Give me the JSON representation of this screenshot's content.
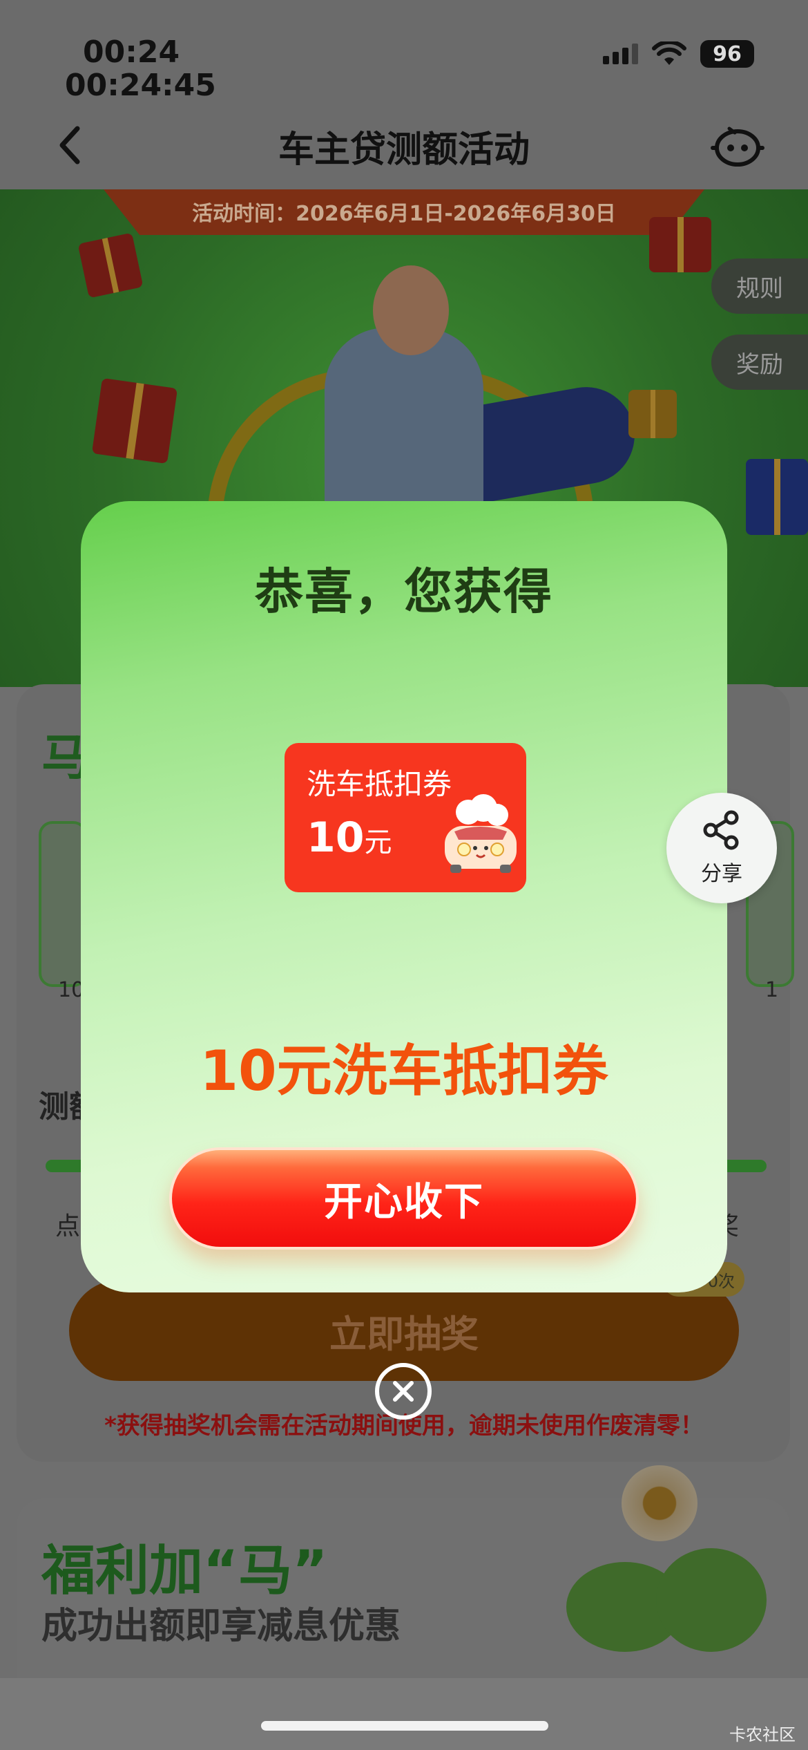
{
  "status_bar": {
    "time": "00:24",
    "time_detail": "00:24:45",
    "battery": "96"
  },
  "nav": {
    "title": "车主贷测额活动",
    "back_icon": "chevron-left-icon",
    "service_icon": "robot-service-icon"
  },
  "banner": {
    "activity_time": "活动时间：2026年6月1日-2026年6月30日",
    "side_tabs": [
      "规则",
      "奖励"
    ]
  },
  "section": {
    "title": "马",
    "mini_labels": [
      "10",
      "1"
    ],
    "subtitle": "测额",
    "left_label": "点",
    "right_label": "奖",
    "count_badge": "0次",
    "draw_button": "立即抽奖",
    "warning": "*获得抽奖机会需在活动期间使用，逾期未使用作废清零！"
  },
  "benefit": {
    "title": "福利加“马”",
    "subtitle": "成功出额即享减息优惠"
  },
  "modal": {
    "title": "恭喜，您获得",
    "coupon": {
      "name": "洗车抵扣券",
      "value": "10",
      "unit": "元"
    },
    "prize_name": "10元洗车抵扣券",
    "accept_button": "开心收下",
    "close_icon": "close-circle-icon"
  },
  "share": {
    "label": "分享",
    "icon": "share-icon"
  },
  "watermark": "卡农社区",
  "colors": {
    "accent_red": "#f7361f",
    "prize_orange": "#f2520c",
    "modal_green": "#65cf4c"
  }
}
